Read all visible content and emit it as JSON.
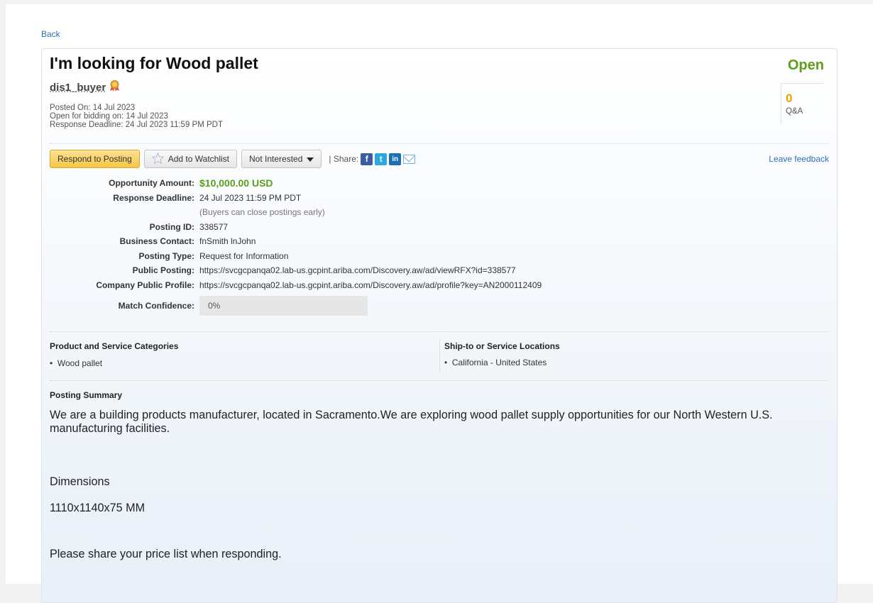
{
  "nav": {
    "back_label": "Back"
  },
  "posting": {
    "title": "I'm looking for Wood pallet",
    "status": "Open",
    "buyer": "dis1_buyer",
    "posted_on": "Posted On:  14 Jul 2023",
    "open_for_bidding": "Open for bidding on:  14 Jul 2023",
    "response_deadline_meta": "Response Deadline:  24 Jul 2023 11:59 PM PDT",
    "qa_count": "0",
    "qa_label": "Q&A"
  },
  "toolbar": {
    "respond_label": "Respond to Posting",
    "watchlist_label": "Add to Watchlist",
    "not_interested_label": "Not Interested",
    "share_label": "| Share:",
    "feedback_label": "Leave feedback",
    "icons": [
      "facebook-icon",
      "twitter-icon",
      "linkedin-icon",
      "email-icon"
    ]
  },
  "details": {
    "amount_label": "Opportunity Amount:",
    "amount_value": "$10,000.00 USD",
    "deadline_label": "Response Deadline:",
    "deadline_value": "24 Jul 2023 11:59 PM PDT",
    "deadline_note": "(Buyers can close postings early)",
    "posting_id_label": "Posting ID:",
    "posting_id_value": "338577",
    "contact_label": "Business Contact:",
    "contact_value": "fnSmith lnJohn",
    "type_label": "Posting Type:",
    "type_value": "Request for Information",
    "public_posting_label": "Public Posting:",
    "public_posting_url": "https://svcgcpanqa02.lab-us.gcpint.ariba.com/Discovery.aw/ad/viewRFX?id=338577",
    "company_profile_label": "Company Public Profile:",
    "company_profile_url": "https://svcgcpanqa02.lab-us.gcpint.ariba.com/Discovery.aw/ad/profile?key=AN2000112409",
    "match_label": "Match Confidence:",
    "match_value": "0%"
  },
  "categories": {
    "heading": "Product and Service Categories",
    "items": [
      "Wood pallet"
    ]
  },
  "locations": {
    "heading": "Ship-to or Service Locations",
    "items": [
      "California - United States"
    ]
  },
  "summary": {
    "heading": "Posting Summary",
    "paragraph1": "We are a building products manufacturer, located in Sacramento.We are exploring wood pallet supply opportunities  for our North Western U.S. manufacturing facilities.",
    "dimensions_heading": "Dimensions",
    "dimensions_value": "1110x1140x75 MM",
    "closing": "Please share your price list  when responding."
  },
  "colors": {
    "status_open": "#5a9e1c",
    "amount": "#5a9e1c",
    "qa_count": "#f0a000",
    "link": "#2e6fb7",
    "primary_button": "#f5c544"
  }
}
